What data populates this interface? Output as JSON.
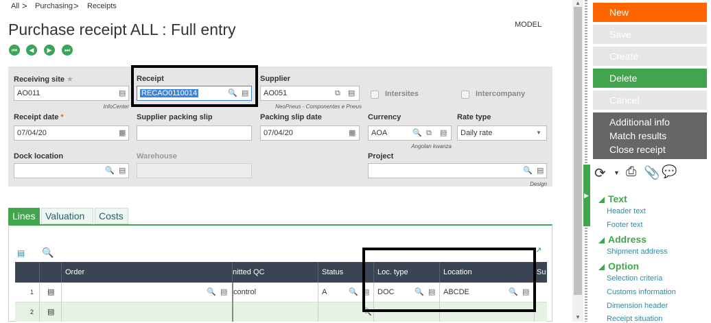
{
  "breadcrumb": {
    "items": [
      "All",
      "Purchasing",
      "Receipts"
    ],
    "separator": ">"
  },
  "title": "Purchase receipt ALL : Full entry",
  "model_label": "MODEL",
  "nav_icons": [
    "first-record-icon",
    "previous-record-icon",
    "next-record-icon",
    "last-record-icon"
  ],
  "form": {
    "receiving_site": {
      "label": "Receiving site",
      "value": "AO011",
      "sub": "InfoCenter"
    },
    "receipt": {
      "label": "Receipt",
      "value": "RECAO0110014"
    },
    "supplier": {
      "label": "Supplier",
      "value": "AO051",
      "sub": "NeoPneus - Componentes e Pneus"
    },
    "intersites": {
      "label": "Intersites"
    },
    "intercompany": {
      "label": "Intercompany"
    },
    "receipt_date": {
      "label": "Receipt date",
      "value": "07/04/20"
    },
    "supplier_packing_slip": {
      "label": "Supplier packing slip",
      "value": ""
    },
    "packing_slip_date": {
      "label": "Packing slip date",
      "value": "07/04/20"
    },
    "currency": {
      "label": "Currency",
      "value": "AOA",
      "sub": "Angolan kwanza"
    },
    "rate_type": {
      "label": "Rate type",
      "value": "Daily rate"
    },
    "dock_location": {
      "label": "Dock location",
      "value": ""
    },
    "warehouse": {
      "label": "Warehouse",
      "value": ""
    },
    "project": {
      "label": "Project",
      "value": "",
      "sub": "Design"
    }
  },
  "tabs": [
    "Lines",
    "Valuation",
    "Costs"
  ],
  "grid": {
    "columns": [
      "Order",
      "nitted QC",
      "Status",
      "Loc. type",
      "Location",
      "Su"
    ],
    "rows": [
      {
        "num": "1",
        "order": "",
        "qc": "control",
        "status": "A",
        "loc_type": "DOC",
        "location": "ABCDE"
      },
      {
        "num": "2",
        "order": "",
        "qc": "",
        "status": "",
        "loc_type": "",
        "location": ""
      }
    ]
  },
  "actions": {
    "new": "New",
    "save": "Save",
    "create": "Create",
    "delete": "Delete",
    "cancel": "Cancel",
    "menu": [
      "Additional info",
      "Match results",
      "Close receipt"
    ]
  },
  "sections": [
    {
      "title": "Text",
      "links": [
        "Header text",
        "Footer text"
      ]
    },
    {
      "title": "Address",
      "links": [
        "Shipment address"
      ]
    },
    {
      "title": "Option",
      "links": [
        "Selection criteria",
        "Customs information",
        "Dimension header",
        "Receipt situation"
      ]
    }
  ],
  "colors": {
    "accent": "#43a44e",
    "new": "#ff6600",
    "delete": "#43a44e",
    "grid_header": "#3b4452",
    "disabled": "#e6e6e6",
    "dark_menu": "#666666",
    "highlight": "#000000"
  }
}
